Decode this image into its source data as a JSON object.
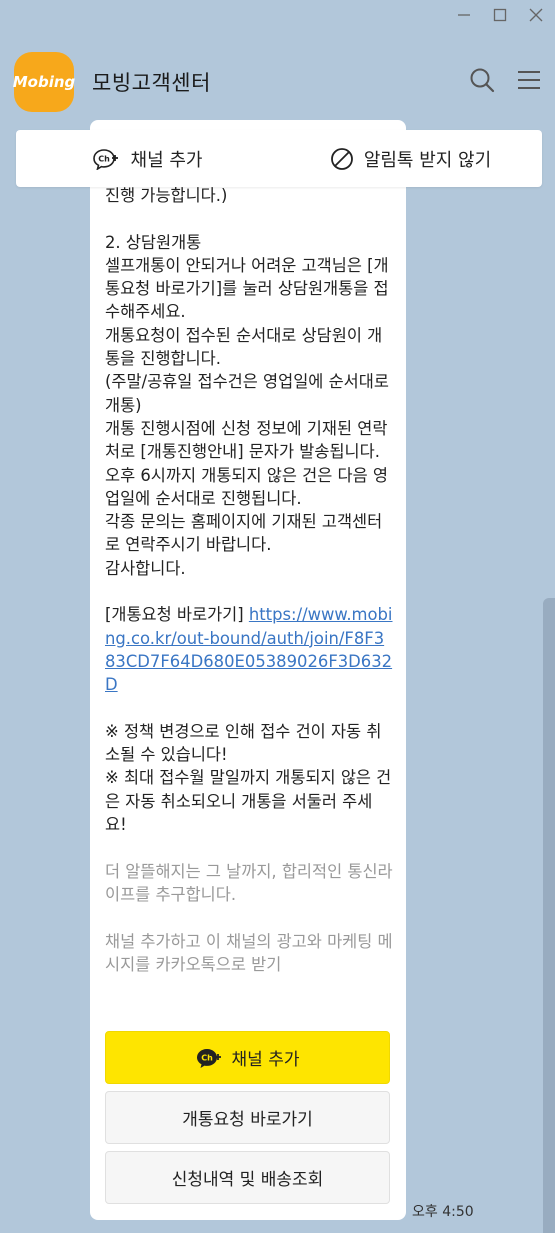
{
  "window": {
    "controls": [
      "minimize",
      "maximize",
      "close"
    ]
  },
  "header": {
    "logo_text": "Mobing",
    "title": "모빙고객센터",
    "icons": [
      "search-icon",
      "menu-icon"
    ]
  },
  "channel_bar": {
    "add_channel": "채널 추가",
    "block_alarm": "알림톡 받지 않기"
  },
  "message": {
    "pre": "진행 가능합니다.)\n\n2. 상담원개통\n셀프개통이 안되거나 어려운 고객님은 [개통요청 바로가기]를 눌러 상담원개통을 접수해주세요.\n개통요청이 접수된 순서대로 상담원이 개통을 진행합니다.\n(주말/공휴일 접수건은 영업일에 순서대로 개통)\n개통 진행시점에 신청 정보에 기재된 연락처로 [개통진행안내] 문자가 발송됩니다.\n오후 6시까지 개통되지 않은 건은 다음 영업일에 순서대로 진행됩니다.\n각종 문의는 홈페이지에 기재된 고객센터로 연락주시기 바랍니다.\n감사합니다.\n\n[개통요청 바로가기] ",
    "link": "https://www.mobing.co.kr/out-bound/auth/join/F8F383CD7F64D680E05389026F3D632D",
    "post": "\n\n※ 정책 변경으로 인해 접수 건이 자동 취소될 수 있습니다!\n※ 최대 접수월 말일까지 개통되지 않은 건은 자동 취소되오니 개통을 서둘러 주세요!\n\n",
    "footer": "더 알뜰해지는 그 날까지, 합리적인 통신라이프를 추구합니다.\n\n채널 추가하고 이 채널의 광고와 마케팅 메시지를 카카오톡으로 받기"
  },
  "buttons": {
    "add_channel": "채널 추가",
    "activation_request": "개통요청 바로가기",
    "order_tracking": "신청내역 및 배송조회"
  },
  "timestamp": "오후 4:50",
  "colors": {
    "background": "#b2c7da",
    "primary_button": "#fee500",
    "logo": "#f7a81b",
    "link": "#3a76c4"
  }
}
